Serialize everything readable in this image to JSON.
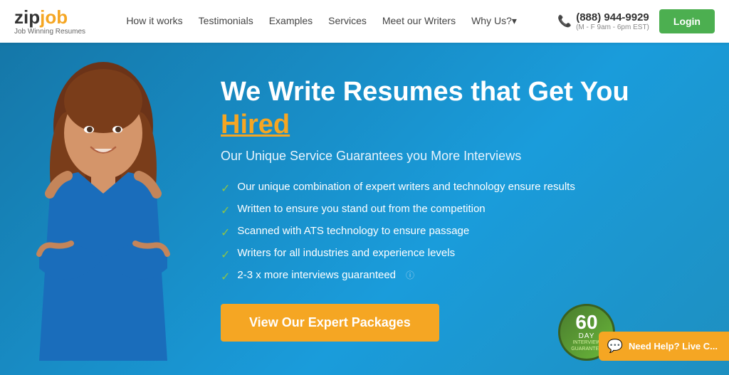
{
  "brand": {
    "name_zip": "zip",
    "name_job": "job",
    "tagline": "Job Winning Resumes"
  },
  "nav": {
    "links": [
      {
        "label": "How it works",
        "id": "how-it-works"
      },
      {
        "label": "Testimonials",
        "id": "testimonials"
      },
      {
        "label": "Examples",
        "id": "examples"
      },
      {
        "label": "Services",
        "id": "services"
      },
      {
        "label": "Meet our Writers",
        "id": "writers"
      },
      {
        "label": "Why Us?",
        "id": "why-us"
      }
    ],
    "phone": "(888) 944-9929",
    "phone_hours": "(M - F 9am - 6pm EST)",
    "login_label": "Login"
  },
  "hero": {
    "title_part1": "We Write Resumes that Get You ",
    "title_highlight": "Hired",
    "subtitle": "Our Unique Service Guarantees you More Interviews",
    "features": [
      "Our unique combination of expert writers and technology ensure results",
      "Written to ensure you stand out from the competition",
      "Scanned with ATS technology to ensure passage",
      "Writers for all industries and experience levels",
      "2-3 x more interviews guaranteed"
    ],
    "cta_label": "View Our Expert Packages"
  },
  "badge": {
    "number": "60",
    "day_label": "DAY",
    "sub_label": "INTERVIEW\nGUARANTEE"
  },
  "chat": {
    "label": "Need Help? Live C..."
  },
  "colors": {
    "hero_bg": "#1a8fc0",
    "accent_orange": "#f5a623",
    "accent_green": "#4caf50",
    "check_green": "#8bc34a"
  }
}
